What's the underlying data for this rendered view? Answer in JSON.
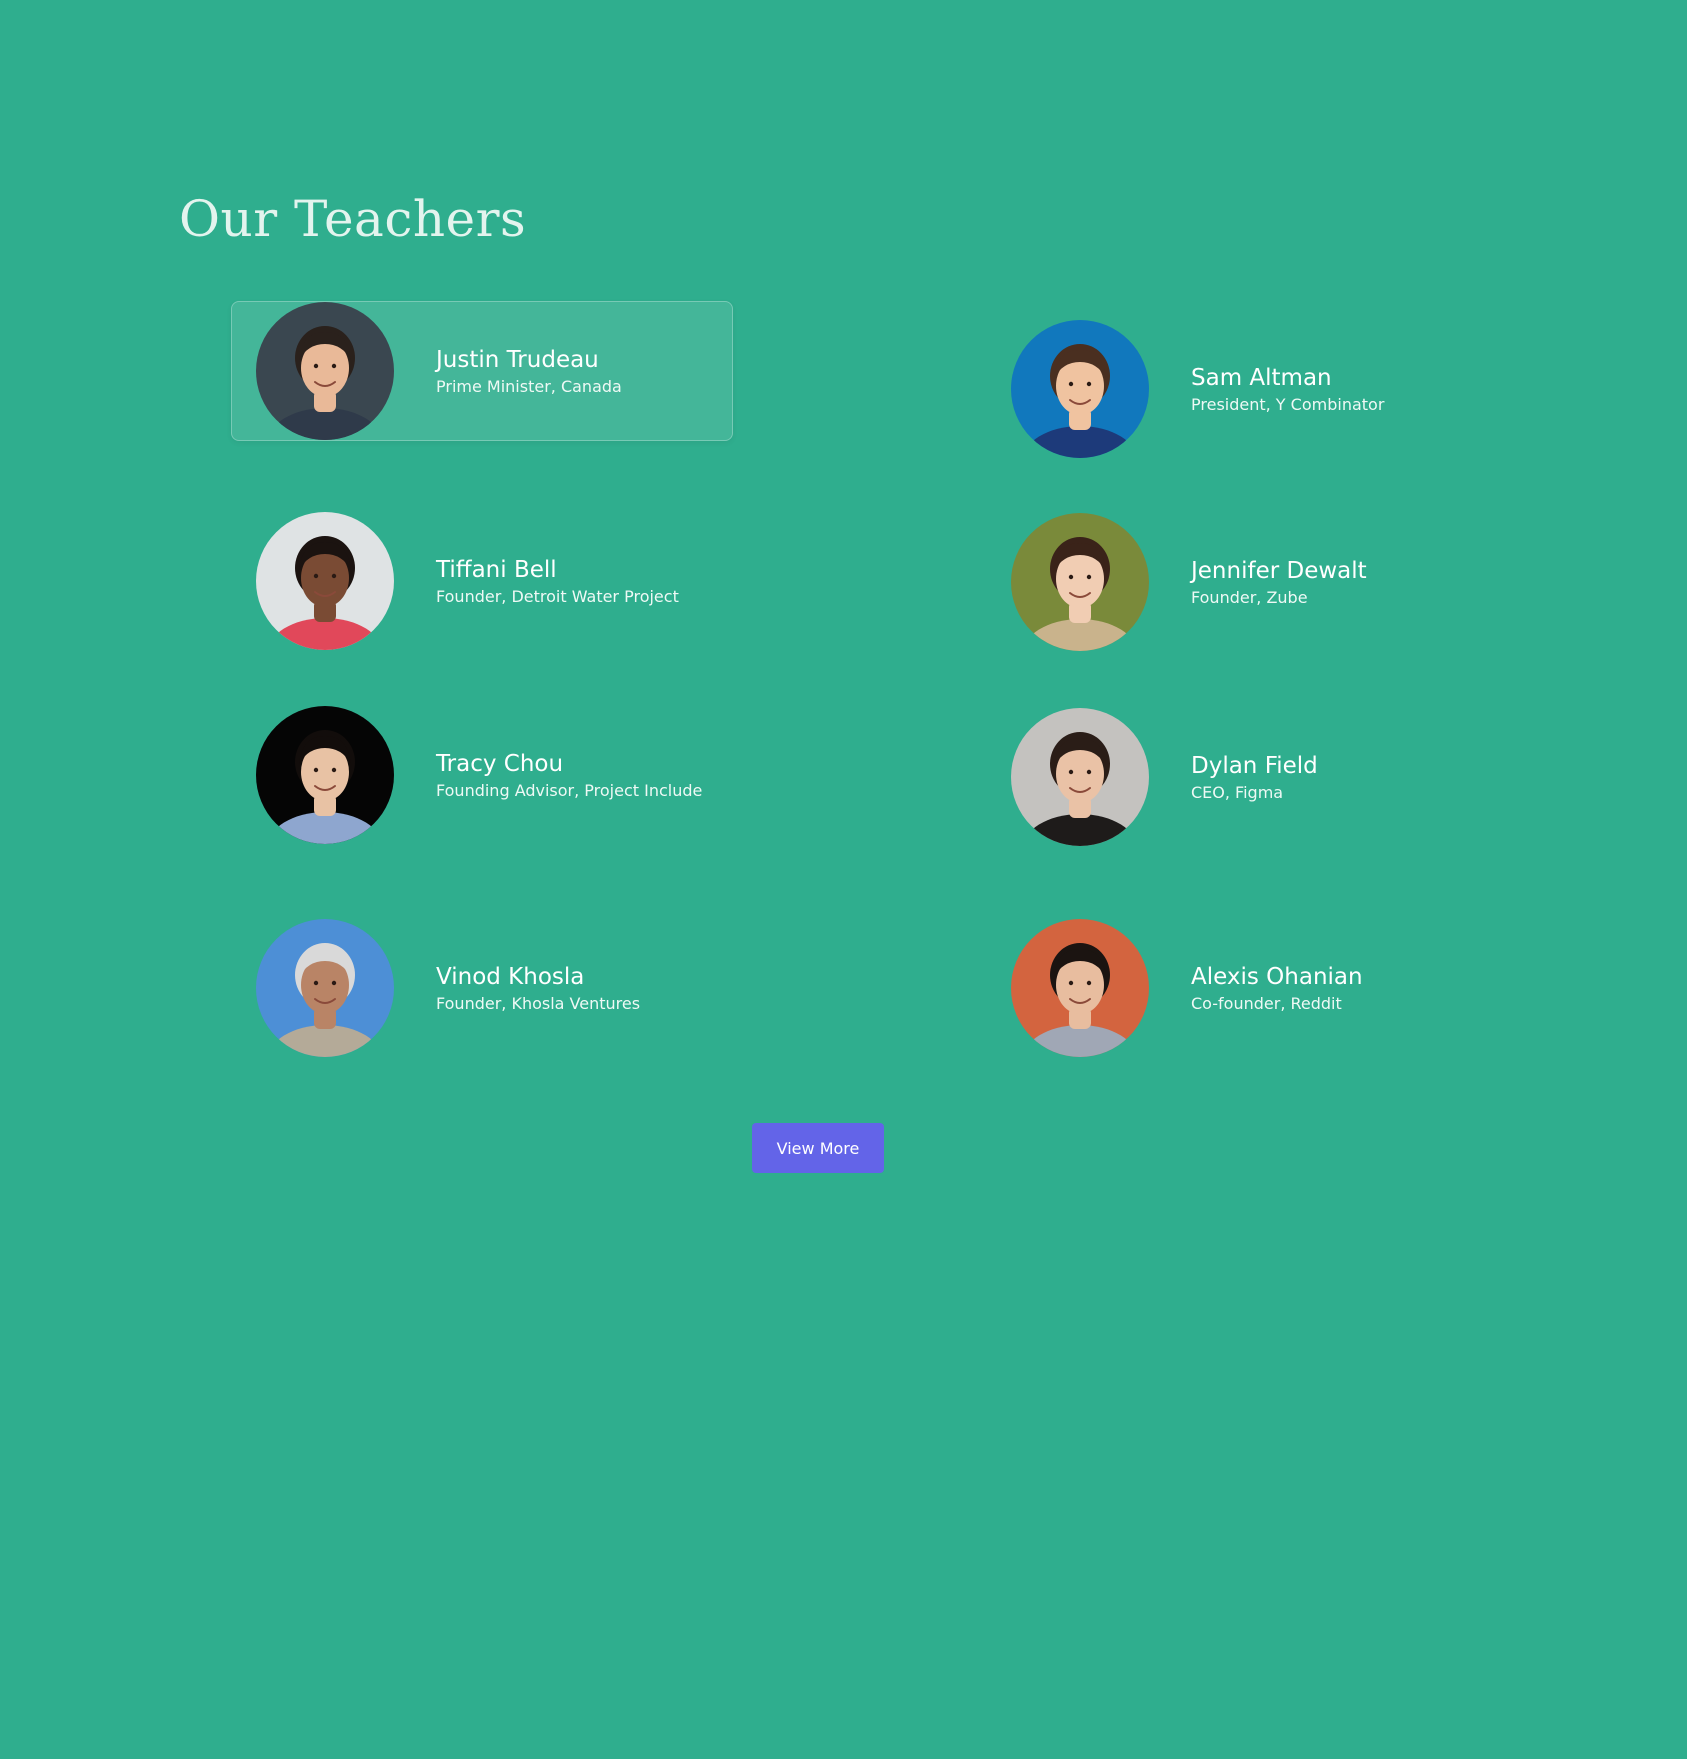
{
  "section": {
    "title": "Our Teachers"
  },
  "teachers": [
    {
      "name": "Justin Trudeau",
      "role": "Prime Minister, Canada",
      "bg": "#3a4750",
      "skin": "#e9b998",
      "hair": "#2a211c",
      "shirt": "#2f3a4a"
    },
    {
      "name": "Sam Altman",
      "role": "President, Y Combinator",
      "bg": "#1178bd",
      "skin": "#f0c3a0",
      "hair": "#4a2f20",
      "shirt": "#1d3a7a"
    },
    {
      "name": "Tiffani Bell",
      "role": "Founder, Detroit Water Project",
      "bg": "#dfe3e4",
      "skin": "#7a4b34",
      "hair": "#1b1310",
      "shirt": "#e1485a"
    },
    {
      "name": "Jennifer Dewalt",
      "role": "Founder, Zube",
      "bg": "#7a8a3a",
      "skin": "#f1cdb3",
      "hair": "#3a2319",
      "shirt": "#c9b38c"
    },
    {
      "name": "Tracy Chou",
      "role": "Founding Advisor, Project Include",
      "bg": "#050505",
      "skin": "#e8c2a4",
      "hair": "#120d0b",
      "shirt": "#8ea6cf"
    },
    {
      "name": "Dylan Field",
      "role": "CEO, Figma",
      "bg": "#c4c2bf",
      "skin": "#eac2a6",
      "hair": "#2a1d17",
      "shirt": "#1e1b1a"
    },
    {
      "name": "Vinod Khosla",
      "role": "Founder, Khosla Ventures",
      "bg": "#4d8fd6",
      "skin": "#b98466",
      "hair": "#d9d9d9",
      "shirt": "#b4aa98"
    },
    {
      "name": "Alexis Ohanian",
      "role": "Co-founder, Reddit",
      "bg": "#d3643f",
      "skin": "#e8bd9f",
      "hair": "#1b1411",
      "shirt": "#a0a7b5"
    }
  ],
  "actions": {
    "view_more_label": "View More",
    "accent": "#6364e8"
  }
}
